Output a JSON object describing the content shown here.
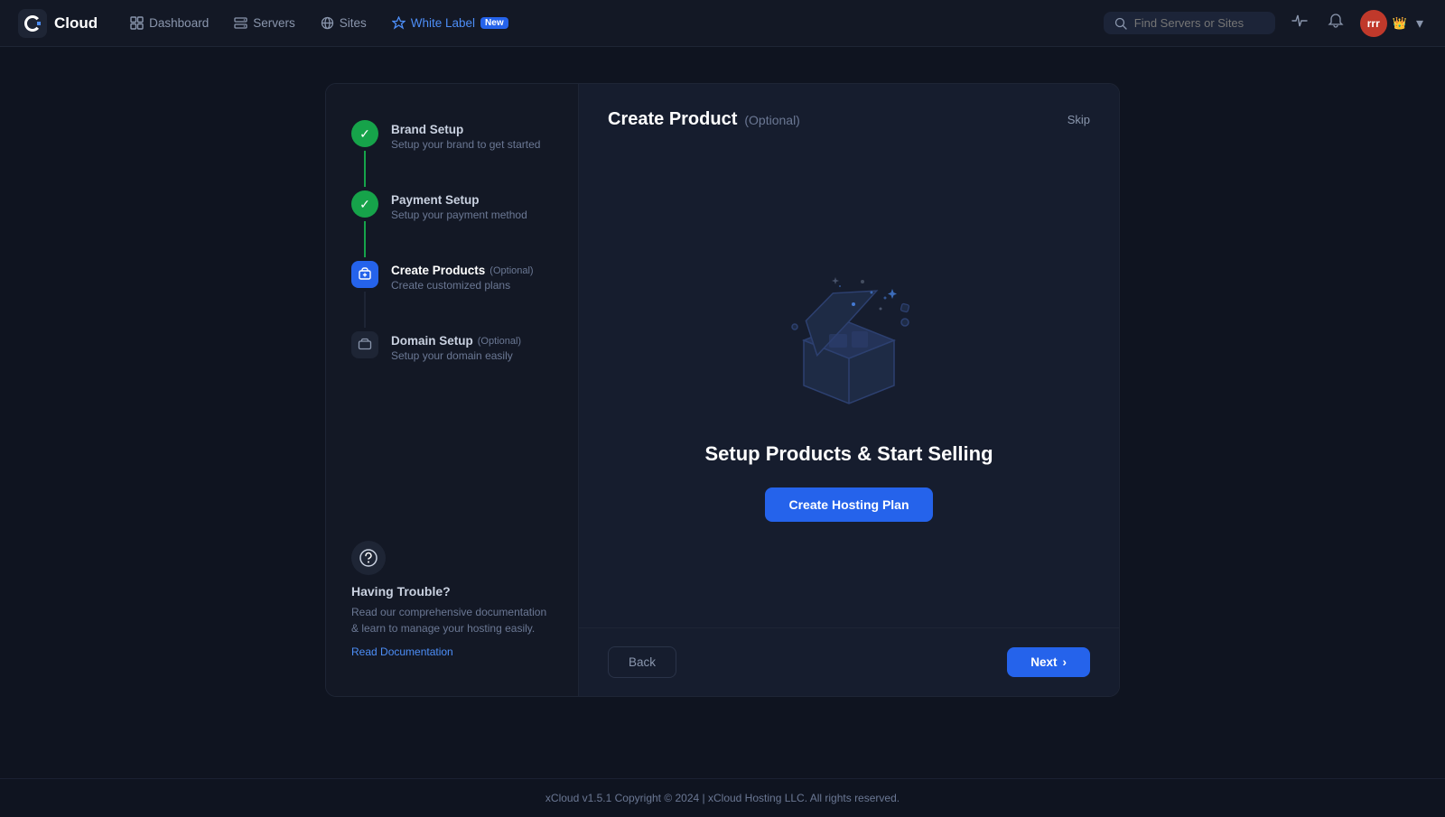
{
  "app": {
    "logo_text": "Cloud",
    "version": "v1.5.1",
    "copyright": "Copyright © 2024 | xCloud Hosting LLC. All rights reserved."
  },
  "nav": {
    "search_placeholder": "Find Servers or Sites",
    "items": [
      {
        "id": "dashboard",
        "label": "Dashboard",
        "active": false
      },
      {
        "id": "servers",
        "label": "Servers",
        "active": false
      },
      {
        "id": "sites",
        "label": "Sites",
        "active": false
      },
      {
        "id": "whitelabel",
        "label": "White Label",
        "active": true,
        "badge": "New"
      }
    ],
    "user": {
      "initials": "rrr",
      "chevron": "▾"
    }
  },
  "steps": [
    {
      "id": "brand-setup",
      "title": "Brand Setup",
      "subtitle": "Setup your brand to get started",
      "state": "completed",
      "optional": false
    },
    {
      "id": "payment-setup",
      "title": "Payment Setup",
      "subtitle": "Setup your payment method",
      "state": "completed",
      "optional": false
    },
    {
      "id": "create-products",
      "title": "Create Products",
      "subtitle": "Create customized plans",
      "state": "active",
      "optional": true,
      "optional_label": "(Optional)"
    },
    {
      "id": "domain-setup",
      "title": "Domain Setup",
      "subtitle": "Setup your domain easily",
      "state": "inactive",
      "optional": true,
      "optional_label": "(Optional)"
    }
  ],
  "help": {
    "title": "Having Trouble?",
    "description": "Read our comprehensive documentation & learn to manage your hosting easily.",
    "link_text": "Read Documentation"
  },
  "main": {
    "title": "Create Product",
    "title_optional": "(Optional)",
    "skip_label": "Skip",
    "setup_title": "Setup Products & Start Selling",
    "create_plan_label": "Create Hosting Plan"
  },
  "footer_buttons": {
    "back": "Back",
    "next": "Next"
  }
}
